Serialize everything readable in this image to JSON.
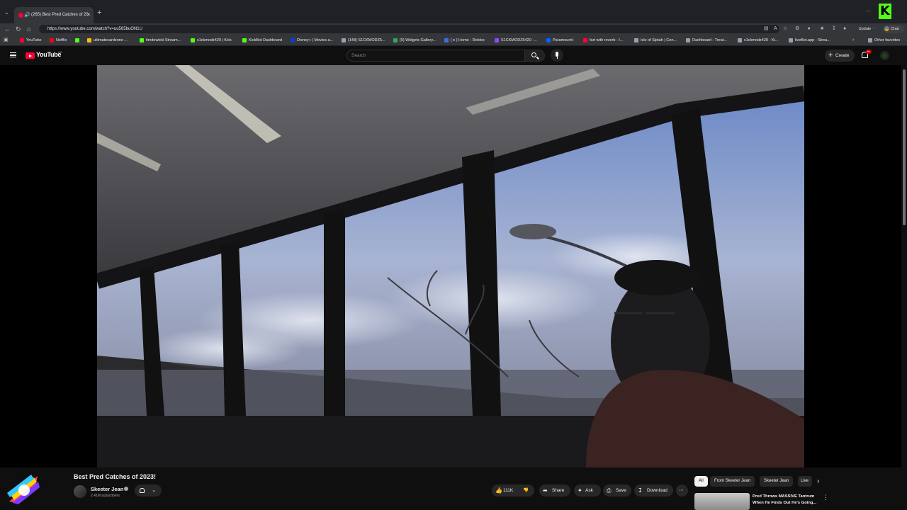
{
  "browser": {
    "tab_title": "(265) Best Pred Catches of 20",
    "url": "https://www.youtube.com/watch?v=uu565buON1U",
    "update_label": "Update",
    "chat_label": "Chat",
    "bookmarks": [
      {
        "label": "YouTube",
        "color": "#ff0033"
      },
      {
        "label": "Netflix",
        "color": "#e50914"
      },
      {
        "label": "",
        "color": "#53fc18"
      },
      {
        "label": "ultimatecardzone ...",
        "color": "#f4c20d"
      },
      {
        "label": "timdewicki Stream...",
        "color": "#53fc18"
      },
      {
        "label": "s1ckmodz420 | Kick",
        "color": "#53fc18"
      },
      {
        "label": "KickBot Dashboard",
        "color": "#53fc18"
      },
      {
        "label": "Disney+ | Movies a...",
        "color": "#113ccf"
      },
      {
        "label": "(148) S1CKMODZ5...",
        "color": "#9aa0a6"
      },
      {
        "label": "(6) Widgets Gallery...",
        "color": "#34a853"
      },
      {
        "label": "( ♦ ) Home - Roblox",
        "color": "#3d6fe0"
      },
      {
        "label": "S1CKMODZ5420 -...",
        "color": "#9146ff"
      },
      {
        "label": "Paramount+",
        "color": "#0064ff"
      },
      {
        "label": "fart with reverb - I...",
        "color": "#ff0033"
      },
      {
        "label": "Isle of Siptah | Con...",
        "color": "#9aa0a6"
      },
      {
        "label": "Dashboard - Treat...",
        "color": "#9aa0a6"
      },
      {
        "label": "s1ckmodz420 - Ki...",
        "color": "#9aa0a6"
      },
      {
        "label": "liveBot.app - Strea...",
        "color": "#9aa0a6"
      },
      {
        "label": "Other favorites",
        "color": "#9aa0a6"
      }
    ]
  },
  "youtube": {
    "logo_text": "YouTube",
    "region": "CA",
    "search_placeholder": "Search",
    "create_label": "Create",
    "notifications_count": "9+"
  },
  "video": {
    "title": "Best Pred Catches of 2023!",
    "channel_name": "Skeeter Jean",
    "subscribers": "2.41M subscribers",
    "likes": "111K",
    "share_label": "Share",
    "ask_label": "Ask",
    "save_label": "Save",
    "download_label": "Download"
  },
  "sidebar": {
    "chips": [
      "All",
      "From Skeeter Jean",
      "Skeeter Jean",
      "Live"
    ],
    "recommended_title": "Pred Throws MASSIVE Tantrum When He Finds Out He's Going..."
  }
}
